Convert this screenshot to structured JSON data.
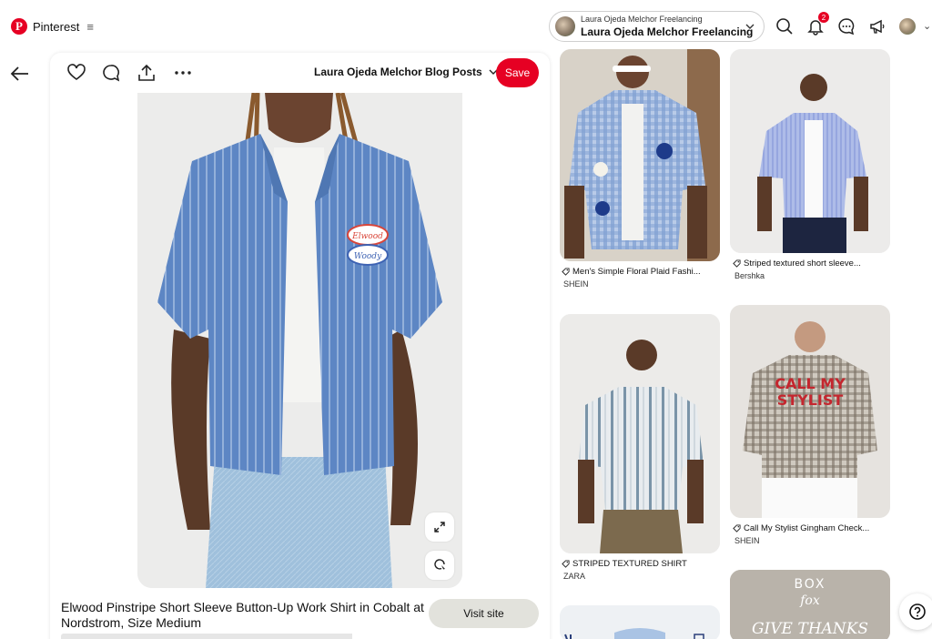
{
  "brand": {
    "name": "Pinterest",
    "logo_letter": "P"
  },
  "account": {
    "subtitle": "Laura Ojeda Melchor Freelancing",
    "name": "Laura Ojeda Melchor Freelancing"
  },
  "notifications": {
    "count": "2"
  },
  "icons": {
    "back": "arrow-left-icon",
    "like": "heart-icon",
    "comment": "speech-bubble-icon",
    "share": "share-upload-icon",
    "more": "ellipsis-icon",
    "search": "search-icon",
    "notifications": "bell-icon",
    "messages": "chat-icon",
    "updates": "megaphone-icon",
    "expand": "expand-icon",
    "visual_search": "visual-search-icon",
    "help": "question-icon",
    "tag": "tag-icon"
  },
  "pin": {
    "board": "Laura Ojeda Melchor Blog Posts",
    "save_label": "Save",
    "title": "Elwood Pinstripe Short Sleeve Button-Up Work Shirt in Cobalt at Nordstrom, Size Medium",
    "visit_label": "Visit site",
    "patch_top": "Elwood",
    "patch_bottom": "Woody"
  },
  "colors": {
    "brand_red": "#e60023",
    "visit_bg": "#e2e2dc"
  },
  "related": [
    {
      "title": "Men's Simple Floral Plaid Fashi...",
      "source": "SHEIN"
    },
    {
      "title": "Striped textured short sleeve...",
      "source": "Bershka"
    },
    {
      "title": "STRIPED TEXTURED SHIRT",
      "source": "ZARA"
    },
    {
      "title": "Call My Stylist Gingham Check...",
      "source": "SHEIN",
      "print_line1": "CALL MY",
      "print_line2": "STYLIST"
    },
    {
      "title": "",
      "source": "",
      "ad_line1": "BOX",
      "ad_line2": "fox",
      "ad_line3": "GIVE THANKS"
    }
  ]
}
